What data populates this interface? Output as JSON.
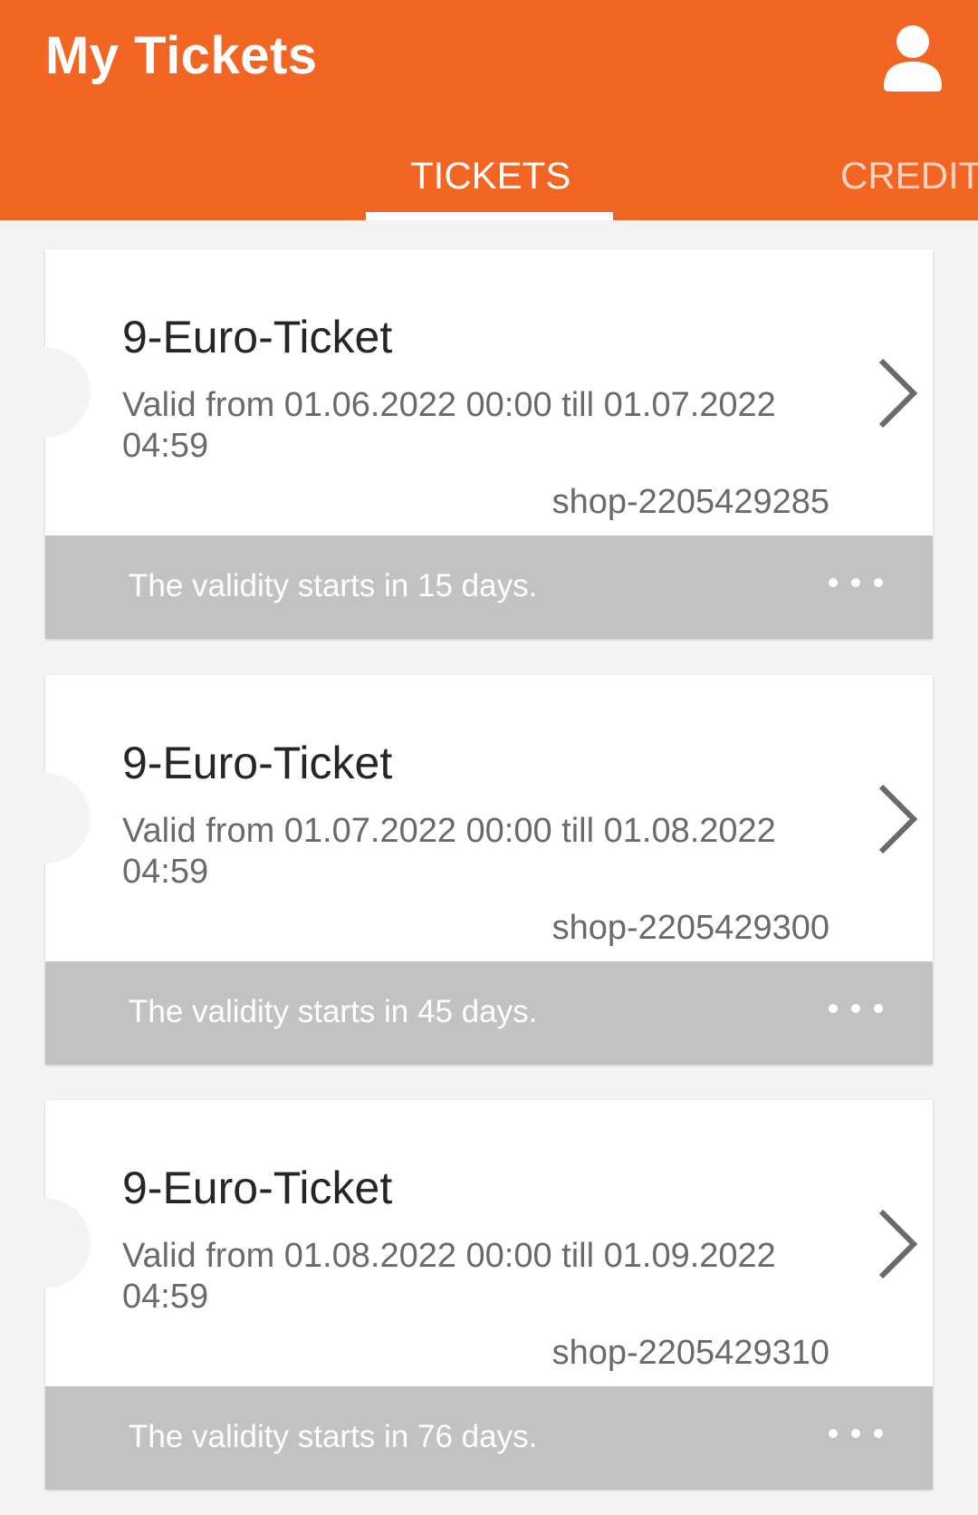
{
  "header": {
    "title": "My Tickets",
    "profile_icon": "person-icon",
    "tabs": [
      {
        "label": "TICKETS",
        "active": true
      },
      {
        "label": "CREDIT",
        "active": false
      }
    ]
  },
  "colors": {
    "brand": "#f26522",
    "status_bar": "#c3c2c2",
    "background": "#f4f4f4"
  },
  "tickets": [
    {
      "name": "9-Euro-Ticket",
      "validity": "Valid from 01.06.2022 00:00 till 01.07.2022 04:59",
      "order_id": "shop-2205429285",
      "status": "The validity starts in 15 days."
    },
    {
      "name": "9-Euro-Ticket",
      "validity": "Valid from 01.07.2022 00:00 till 01.08.2022 04:59",
      "order_id": "shop-2205429300",
      "status": "The validity starts in 45 days."
    },
    {
      "name": "9-Euro-Ticket",
      "validity": "Valid from 01.08.2022 00:00 till 01.09.2022 04:59",
      "order_id": "shop-2205429310",
      "status": "The validity starts in 76 days."
    }
  ]
}
